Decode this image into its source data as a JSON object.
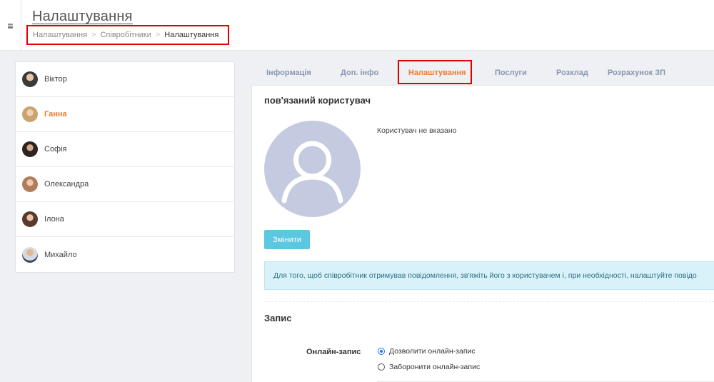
{
  "header": {
    "title": "Налаштування",
    "breadcrumb": {
      "item1": "Налаштування",
      "separator": ">",
      "item2": "Співробітники",
      "current": "Налаштування"
    }
  },
  "icons": {
    "menu": "hamburger-icon",
    "avatar_placeholder": "user-placeholder-icon"
  },
  "colors": {
    "accent": "#f07a2e",
    "highlight_box": "#e00000",
    "button": "#5bc8e0",
    "info_bg": "#d9f2f9"
  },
  "employees": [
    {
      "name": "Віктор"
    },
    {
      "name": "Ганна",
      "active": true
    },
    {
      "name": "Софія"
    },
    {
      "name": "Олександра"
    },
    {
      "name": "Ілона"
    },
    {
      "name": "Михайло"
    }
  ],
  "tabs": [
    {
      "label": "Інформація"
    },
    {
      "label": "Доп. інфо"
    },
    {
      "label": "Налаштування",
      "active": true
    },
    {
      "label": "Послуги"
    },
    {
      "label": "Розклад"
    },
    {
      "label": "Розрахунок ЗП"
    }
  ],
  "linked_user": {
    "section_title": "пов'язаний користувач",
    "note": "Користувач не вказано",
    "change_button": "Змінити",
    "info": "Для того, щоб співробітник отримував повідомлення, зв'яжіть його з користувачем і, при необхідності, налаштуйте повідо"
  },
  "booking": {
    "section_title": "Запис",
    "online_label": "Онлайн-запис",
    "options": [
      {
        "label": "Дозволити онлайн-запис",
        "checked": true
      },
      {
        "label": "Заборонити онлайн-запис",
        "checked": false
      }
    ]
  }
}
